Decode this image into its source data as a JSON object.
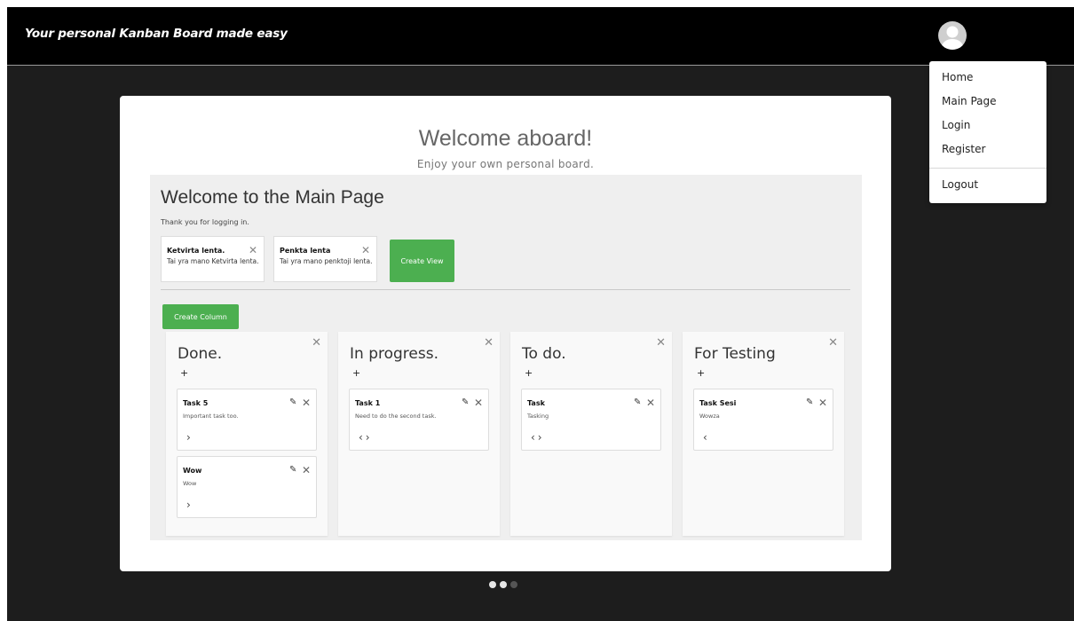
{
  "header": {
    "brand": "Your personal Kanban Board made easy"
  },
  "menu": {
    "items": [
      "Home",
      "Main Page",
      "Login",
      "Register"
    ],
    "logout": "Logout"
  },
  "welcome": {
    "title": "Welcome aboard!",
    "subtitle": "Enjoy your own personal board."
  },
  "main": {
    "title": "Welcome to the Main Page",
    "subtitle": "Thank you for logging in.",
    "views": [
      {
        "title": "Ketvirta lenta.",
        "desc": "Tai yra mano Ketvirta lenta."
      },
      {
        "title": "Penkta lenta",
        "desc": "Tai yra mano penktoji lenta."
      }
    ],
    "create_view_label": "Create View",
    "create_column_label": "Create Column"
  },
  "columns": [
    {
      "title": "Done.",
      "add": "+",
      "tasks": [
        {
          "title": "Task 5",
          "desc": "Important task too.",
          "nav": "›"
        },
        {
          "title": "Wow",
          "desc": "Wow",
          "nav": "›"
        }
      ]
    },
    {
      "title": "In progress.",
      "add": "+",
      "tasks": [
        {
          "title": "Task 1",
          "desc": "Need to do the second task.",
          "nav": "‹›"
        }
      ]
    },
    {
      "title": "To do.",
      "add": "+",
      "tasks": [
        {
          "title": "Task",
          "desc": "Tasking",
          "nav": "‹›"
        }
      ]
    },
    {
      "title": "For Testing",
      "add": "+",
      "tasks": [
        {
          "title": "Task Sesi",
          "desc": "Wowza",
          "nav": "‹"
        }
      ]
    }
  ],
  "colors": {
    "accent_green": "#4caf50",
    "header_bg": "#000000",
    "page_bg": "#1d1d1d"
  },
  "carousel": {
    "count": 3,
    "active_index": 2
  }
}
